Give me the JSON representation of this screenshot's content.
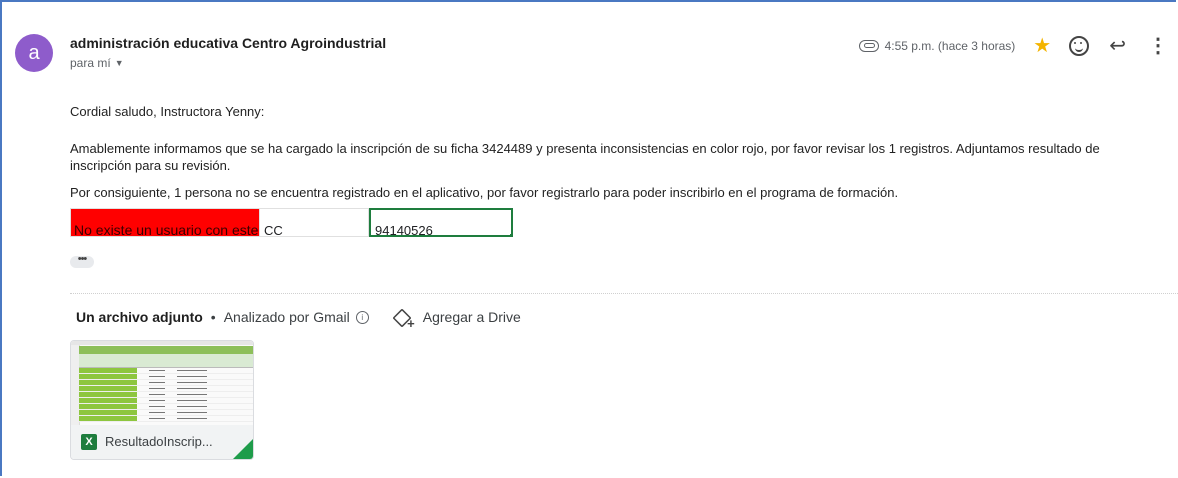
{
  "email": {
    "avatar_letter": "a",
    "sender": "administración educativa Centro Agroindustrial",
    "to": "para mí",
    "time": "4:55 p.m. (hace 3 horas)"
  },
  "body": {
    "greeting": "Cordial saludo, Instructora Yenny:",
    "paragraph1": "Amablemente informamos que se ha cargado la inscripción de su ficha 3424489 y presenta inconsistencias en color rojo, por favor revisar los 1 registros. Adjuntamos resultado de inscripción para su revisión.",
    "paragraph2": "Por consiguiente, 1 persona no se encuentra registrado en el aplicativo, por favor registrarlo para poder inscribirlo en el programa de formación."
  },
  "table": {
    "cells": [
      "No existe un usuario con este",
      "CC",
      "94140526"
    ],
    "error_color": "#ff0000"
  },
  "attachments": {
    "title": "Un archivo adjunto",
    "separator": "•",
    "scanned": "Analizado por Gmail",
    "info_glyph": "i",
    "add_drive": "Agregar a Drive",
    "file": {
      "name": "ResultadoInscrip...",
      "icon_letter": "X",
      "icon_color": "#1e7d3e"
    }
  },
  "icons": {
    "star": "★",
    "reply": "↩",
    "more": "⋮",
    "caret": "▼",
    "dots": "•••"
  },
  "colors": {
    "avatar": "#8e5ccb",
    "star": "#f4b400",
    "frame": "#4a78c2"
  }
}
